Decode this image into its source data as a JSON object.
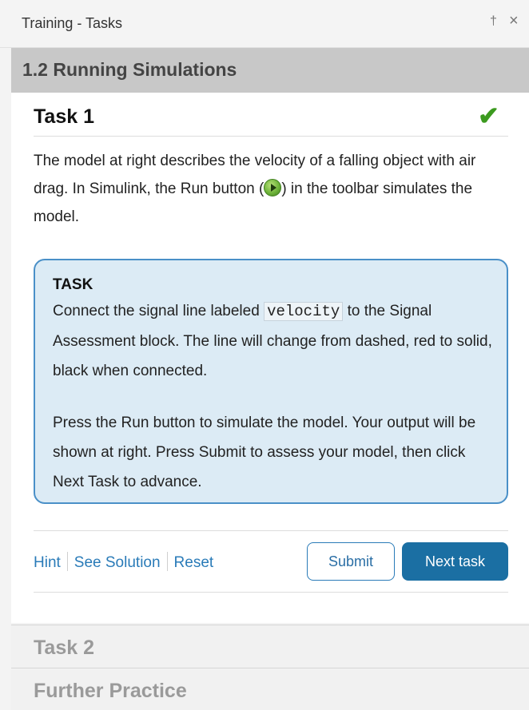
{
  "window": {
    "title": "Training - Tasks",
    "pin_glyph": "†",
    "close_glyph": "×"
  },
  "section": {
    "title": "1.2 Running Simulations"
  },
  "task1": {
    "title": "Task 1",
    "status": "completed",
    "check_glyph": "✔",
    "check_color": "#3c9a1f",
    "intro_before": "The model at right describes the velocity of a falling object with air drag. In Simulink, the Run button (",
    "intro_after": ") in the toolbar simulates the model.",
    "run_icon": "run-play-icon",
    "taskbox": {
      "label": "TASK",
      "p1_before": "Connect the signal line labeled ",
      "p1_code": "velocity",
      "p1_after": " to the Signal Assessment block. The line will change from dashed, red to solid, black when connected.",
      "p2": "Press the Run button to simulate the model. Your output will be shown at right. Press Submit to assess your model, then click Next Task to advance."
    },
    "links": {
      "hint": "Hint",
      "solution": "See Solution",
      "reset": "Reset"
    },
    "buttons": {
      "submit": "Submit",
      "next": "Next task"
    }
  },
  "collapsed_sections": [
    {
      "title": "Task 2"
    },
    {
      "title": "Further Practice"
    }
  ],
  "colors": {
    "accent": "#1b6fa3",
    "link": "#2a7bb8",
    "taskbox_bg": "#dcebf5",
    "taskbox_border": "#4a90c8",
    "header_bg": "#c8c8c8"
  }
}
